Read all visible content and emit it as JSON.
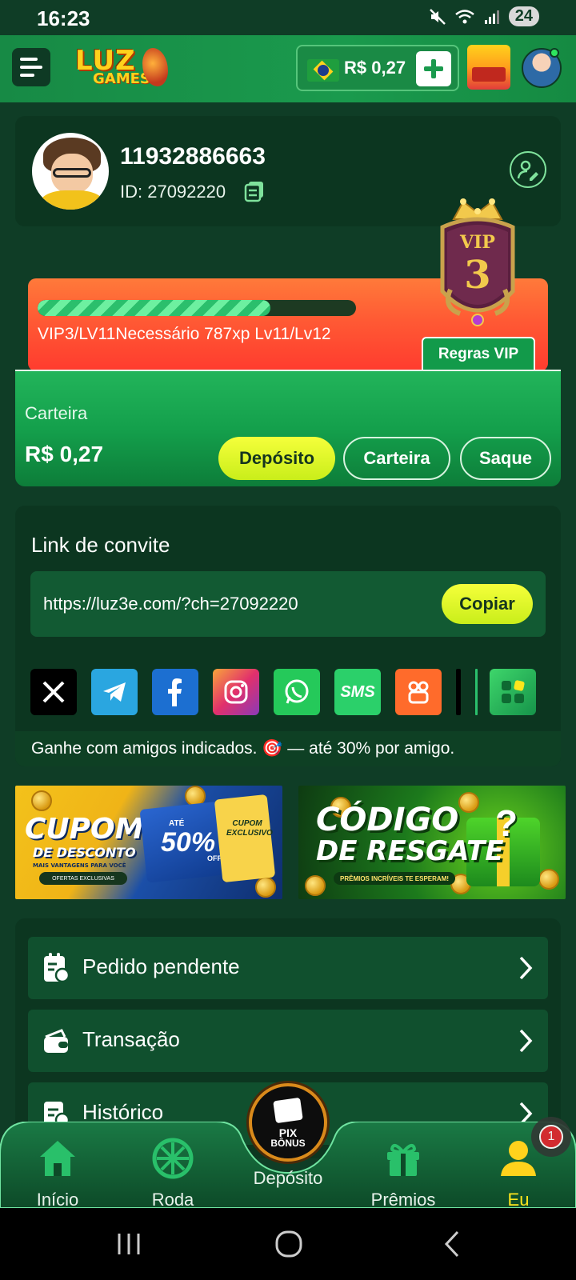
{
  "status_bar": {
    "time": "16:23",
    "battery": "24",
    "signal_label": "5"
  },
  "header": {
    "logo_top": "LUZ",
    "logo_bottom": "GAMES",
    "balance": "R$ 0,27",
    "icons": [
      "menu-icon",
      "flag-brazil-icon",
      "plus-icon",
      "treasure-chest-icon",
      "avatar"
    ]
  },
  "profile": {
    "username": "11932886663",
    "id_label": "ID: 27092220",
    "vip_level": "3",
    "vip_word": "VIP"
  },
  "vip": {
    "progress_percent": 73,
    "text": "VIP3/LV11Necessário 787xp Lv11/Lv12",
    "rules_button": "Regras VIP"
  },
  "wallet": {
    "label": "Carteira",
    "amount": "R$ 0,27",
    "buttons": {
      "deposit": "Depósito",
      "wallet": "Carteira",
      "withdraw": "Saque"
    }
  },
  "invite": {
    "title": "Link de convite",
    "url": "https://luz3e.com/?ch=27092220",
    "copy_button": "Copiar",
    "share_targets": [
      "x-icon",
      "telegram-icon",
      "facebook-icon",
      "instagram-icon",
      "whatsapp-icon",
      "sms-icon",
      "kwai-icon",
      "more-apps-icon"
    ],
    "sms_label": "SMS",
    "note": "Ganhe com amigos indicados. 🎯 — até 30% por amigo."
  },
  "banners": {
    "coupon": {
      "title": "CUPOM",
      "subtitle": "DE DESCONTO",
      "small": "MAIS VANTAGENS PARA VOCÊ",
      "pill": "OFERTAS EXCLUSIVAS",
      "upto": "ATÉ",
      "percent": "50%",
      "off": "OFF",
      "exclusive": "CUPOM EXCLUSIVO"
    },
    "redeem": {
      "line1": "CÓDIGO",
      "line2": "DE RESGATE",
      "tag": "PRÊMIOS INCRÍVEIS TE ESPERAM!",
      "mark": "?"
    }
  },
  "menu": [
    {
      "label": "Pedido pendente",
      "icon": "pending-order-icon"
    },
    {
      "label": "Transação",
      "icon": "wallet-icon"
    },
    {
      "label": "Histórico",
      "icon": "history-icon"
    }
  ],
  "bottom_nav": {
    "items": [
      "Início",
      "Roda",
      "Depósito",
      "Prêmios",
      "Eu"
    ],
    "active": "Eu",
    "pix_top": "PIX",
    "pix_bottom": "BÔNUS",
    "notification_count": "1"
  },
  "colors": {
    "background": "#0f3d26",
    "card": "#0c3620",
    "accent_yellow": "#f5ff3b",
    "header_green": "#1a9a4d",
    "vip_orange": "#ff5a34",
    "active_nav": "#ffe61c"
  }
}
